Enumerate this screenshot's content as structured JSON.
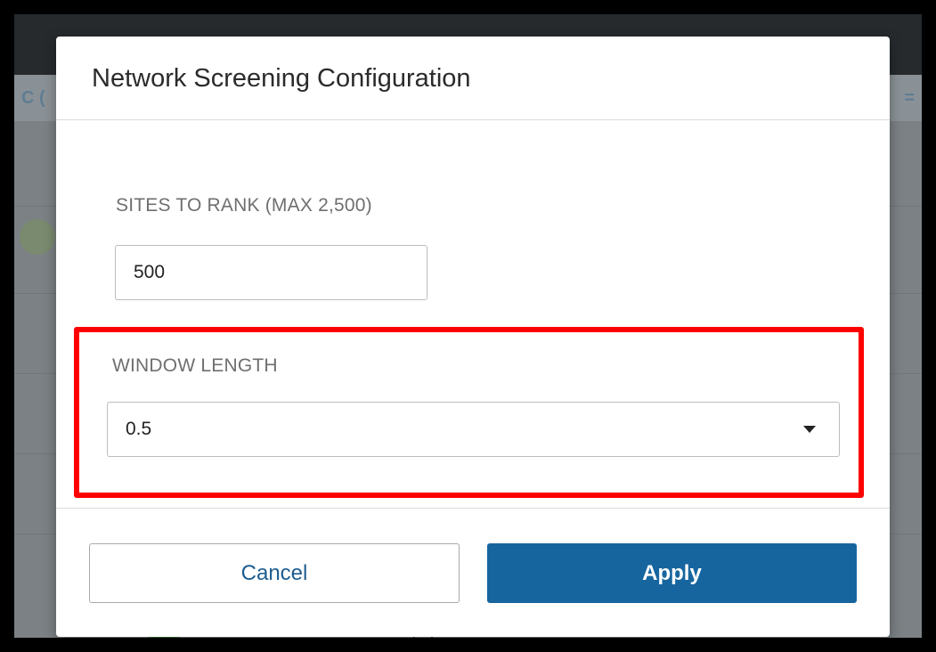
{
  "background": {
    "left_fragment": "C (",
    "right_fragment": "="
  },
  "modal": {
    "title": "Network Screening Configuration",
    "sites_to_rank": {
      "label": "SITES TO RANK (MAX 2,500)",
      "value": "500"
    },
    "window_length": {
      "label": "WINDOW LENGTH",
      "selected": "0.5",
      "icon": "caret-down-icon"
    },
    "buttons": {
      "cancel": "Cancel",
      "apply": "Apply"
    }
  },
  "colors": {
    "primary": "#17659f",
    "highlight": "#ff0000",
    "cancel_text": "#1d5d91"
  }
}
